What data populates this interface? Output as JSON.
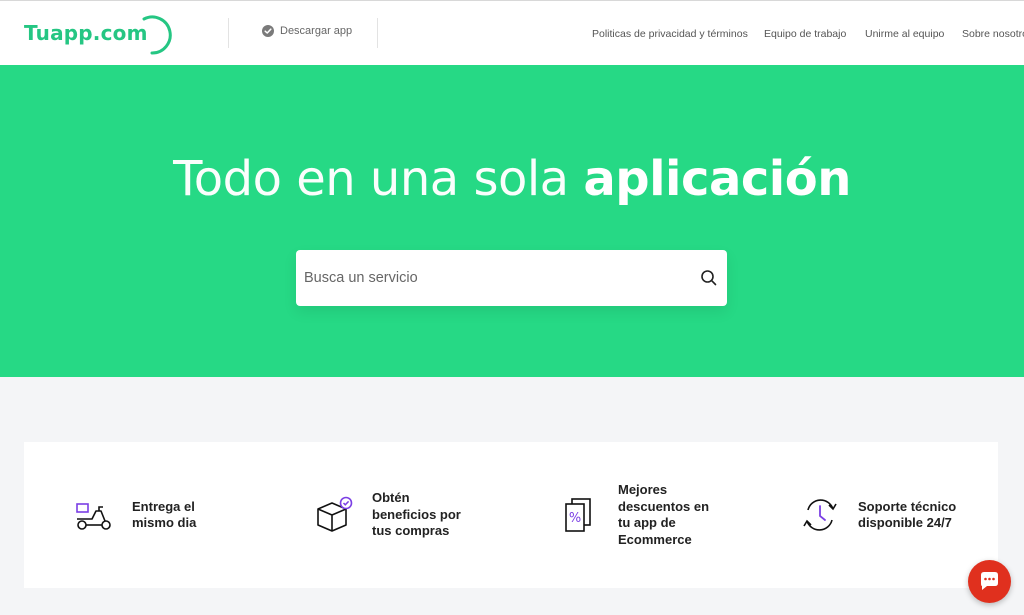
{
  "header": {
    "logo_text": "Tuapp.com",
    "download_label": "Descargar app",
    "nav": [
      "Politicas de privacidad y términos",
      "Equipo de trabajo",
      "Unirme al equipo",
      "Sobre nosotros"
    ]
  },
  "hero": {
    "title_light": "Todo en una sola",
    "title_bold": "aplicación",
    "search_placeholder": "Busca un servicio"
  },
  "features": [
    {
      "label": "Entrega el mismo dia",
      "icon": "scooter-icon"
    },
    {
      "label": "Obtén beneficios por tus compras",
      "icon": "box-check-icon"
    },
    {
      "label": "Mejores descuentos en tu app de Ecommerce",
      "icon": "discount-icon"
    },
    {
      "label": "Soporte técnico disponible 24/7",
      "icon": "clock-support-icon"
    }
  ],
  "colors": {
    "brand": "#26d985",
    "logo": "#25c683",
    "chat": "#e0301e",
    "accent": "#7b3fe4"
  }
}
